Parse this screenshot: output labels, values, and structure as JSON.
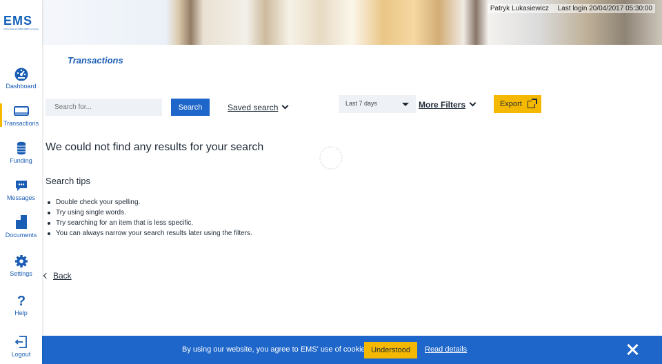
{
  "app": {
    "logo": "EMS",
    "logo_sub": "A First Data and ABN AMRO company"
  },
  "header": {
    "user_name": "Patryk Lukasiewicz",
    "last_login": "Last login 20/04/2017 05:30:00"
  },
  "sidebar": {
    "items": [
      {
        "label": "Dashboard",
        "icon": "dashboard-gauge-icon"
      },
      {
        "label": "Transactions",
        "icon": "card-icon",
        "active": true
      },
      {
        "label": "Funding",
        "icon": "coins-icon"
      },
      {
        "label": "Messages",
        "icon": "chat-bubble-icon"
      },
      {
        "label": "Documents",
        "icon": "document-icon"
      },
      {
        "label": "Settings",
        "icon": "gear-icon"
      },
      {
        "label": "Help",
        "icon": "question-icon"
      },
      {
        "label": "Logout",
        "icon": "logout-icon"
      }
    ]
  },
  "main": {
    "title": "Transactions",
    "search": {
      "placeholder": "Search for...",
      "button": "Search"
    },
    "saved_search": "Saved search",
    "date_filter": "Last 7 days",
    "more_filters": "More Filters",
    "export": "Export",
    "no_results": "We could not find any results for your search",
    "tips_title": "Search tips",
    "tips": [
      "Double check your spelling.",
      "Try using single words.",
      "Try searching for an item that is less specific.",
      "You can always narrow your search results later using the filters."
    ],
    "back": "Back"
  },
  "cookie": {
    "text": "By using our website, you agree to EMS' use of cookies.",
    "accept": "Understood",
    "details": "Read details"
  },
  "colors": {
    "primary": "#1e66c9",
    "accent": "#f5b800",
    "text": "#1f2a37"
  }
}
